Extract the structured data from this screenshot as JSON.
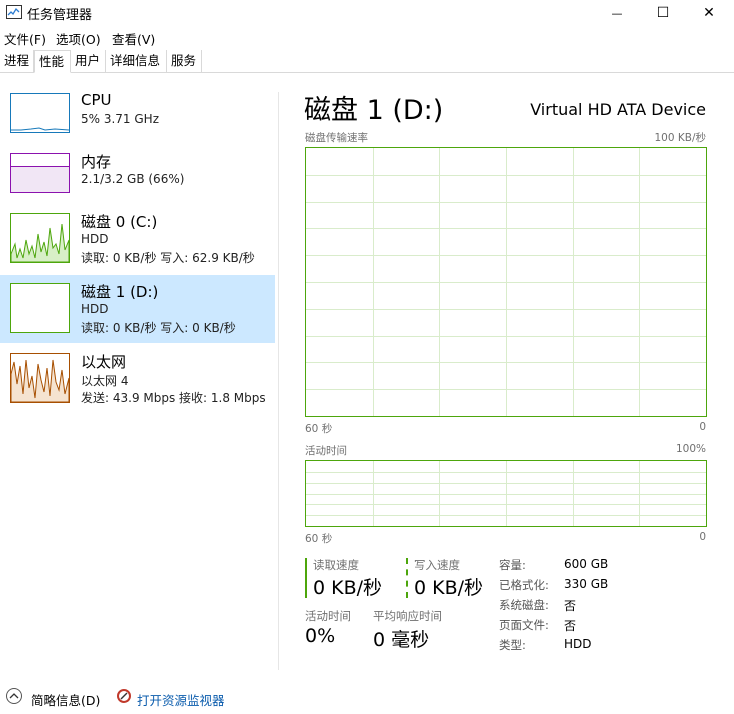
{
  "window": {
    "title": "任务管理器",
    "minimize_glyph": "—",
    "maximize_glyph": "☐",
    "close_glyph": "✕"
  },
  "menu": [
    "文件(F)",
    "选项(O)",
    "查看(V)"
  ],
  "tabs": [
    "进程",
    "性能",
    "用户",
    "详细信息",
    "服务"
  ],
  "active_tab": "性能",
  "sidebar": {
    "items": [
      {
        "name": "CPU",
        "line1": "5% 3.71 GHz",
        "line2": "",
        "color": "#1779ba"
      },
      {
        "name": "内存",
        "line1": "2.1/3.2 GB (66%)",
        "line2": "",
        "color": "#8b12ae"
      },
      {
        "name": "磁盘 0 (C:)",
        "line1": "HDD",
        "line2": "读取: 0 KB/秒 写入: 62.9 KB/秒",
        "color": "#4da60c"
      },
      {
        "name": "磁盘 1 (D:)",
        "line1": "HDD",
        "line2": "读取: 0 KB/秒 写入: 0 KB/秒",
        "color": "#4da60c"
      },
      {
        "name": "以太网",
        "line1": "以太网 4",
        "line2": "发送: 43.9 Mbps 接收: 1.8 Mbps",
        "color": "#a74f01"
      }
    ],
    "selected": "磁盘 1 (D:)"
  },
  "detail": {
    "title": "磁盘 1 (D:)",
    "device": "Virtual HD ATA Device",
    "graph1": {
      "label": "磁盘传输速率",
      "max": "100 KB/秒",
      "x_left": "60 秒",
      "x_right": "0"
    },
    "graph2": {
      "label": "活动时间",
      "max": "100%",
      "x_left": "60 秒",
      "x_right": "0"
    },
    "stats": {
      "read_label": "读取速度",
      "read_value": "0 KB/秒",
      "write_label": "写入速度",
      "write_value": "0 KB/秒",
      "active_label": "活动时间",
      "active_value": "0%",
      "response_label": "平均响应时间",
      "response_value": "0 毫秒"
    },
    "properties": [
      {
        "label": "容量:",
        "value": "600 GB"
      },
      {
        "label": "已格式化:",
        "value": "330 GB"
      },
      {
        "label": "系统磁盘:",
        "value": "否"
      },
      {
        "label": "页面文件:",
        "value": "否"
      },
      {
        "label": "类型:",
        "value": "HDD"
      }
    ]
  },
  "footer": {
    "fewer_details": "简略信息(D)",
    "resource_monitor": "打开资源监视器"
  },
  "colors": {
    "selected_bg": "#cce8ff",
    "disk_green": "#4da60c",
    "link_blue": "#0b5cad"
  }
}
